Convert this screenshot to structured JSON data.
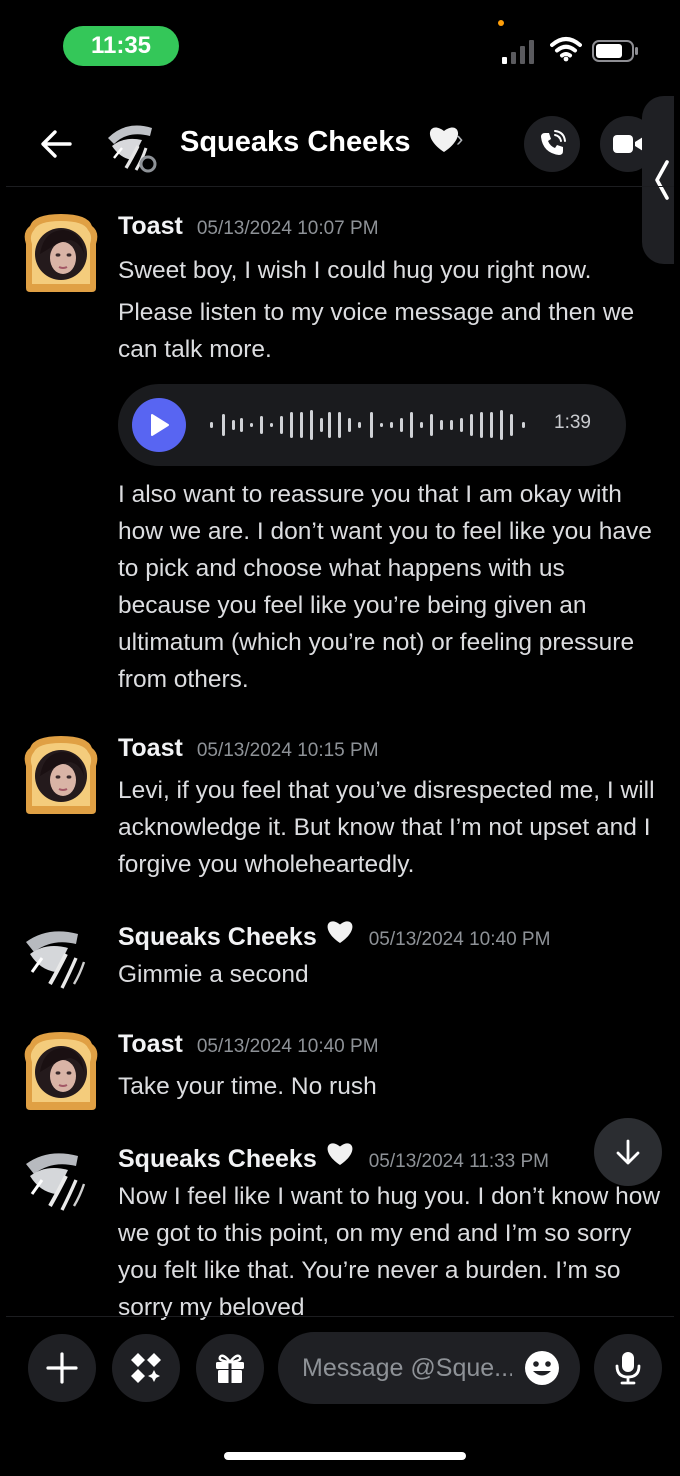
{
  "status_bar": {
    "time": "11:35"
  },
  "header": {
    "title": "Squeaks Cheeks",
    "title_emoji": "white-heart",
    "chevron": "›"
  },
  "messages": [
    {
      "author": "Toast",
      "timestamp": "05/13/2024 10:07 PM",
      "paragraphs": [
        "Sweet boy, I wish I could hug you right now.",
        "Please listen to my voice message and then we can talk more."
      ],
      "voice": {
        "duration": "1:39"
      },
      "paragraphs_after": [
        "I also want to reassure you that I am okay with how we are. I don’t want you to feel like you have to pick and choose what happens with us because you feel like you’re being given an ultimatum (which you’re not) or feeling pressure from others."
      ]
    },
    {
      "author": "Toast",
      "timestamp": "05/13/2024 10:15 PM",
      "paragraphs": [
        "Levi, if you feel that you’ve disrespected me, I will acknowledge it. But know that I’m not upset and I forgive you wholeheartedly."
      ]
    },
    {
      "author": "Squeaks Cheeks",
      "timestamp": "05/13/2024 10:40 PM",
      "paragraphs": [
        "Gimmie a second"
      ]
    },
    {
      "author": "Toast",
      "timestamp": "05/13/2024 10:40 PM",
      "paragraphs": [
        "Take your time. No rush"
      ]
    },
    {
      "author": "Squeaks Cheeks",
      "timestamp": "05/13/2024 11:33 PM",
      "paragraphs": [
        "Now I feel like I want to hug you. I don’t know how we got to this point, on my end and I’m so sorry you felt like that. You’re never a burden. I’m so sorry my beloved"
      ]
    }
  ],
  "composer": {
    "placeholder": "Message @Sque..."
  },
  "colors": {
    "accent": "#5865f2",
    "time_pill": "#34c759",
    "background": "#000000"
  },
  "icons": [
    "back-arrow-icon",
    "phone-call-icon",
    "video-call-icon",
    "plus-icon",
    "apps-icon",
    "gift-icon",
    "emoji-icon",
    "microphone-icon",
    "arrow-down-icon",
    "play-icon"
  ]
}
